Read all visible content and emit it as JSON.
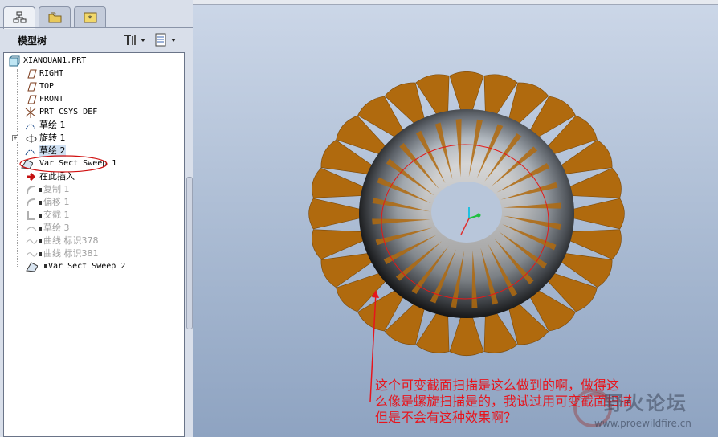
{
  "model_tree": {
    "header": "模型树",
    "root": "XIANQUAN1.PRT",
    "items": [
      {
        "label": "RIGHT"
      },
      {
        "label": "TOP"
      },
      {
        "label": "FRONT"
      },
      {
        "label": "PRT_CSYS_DEF"
      },
      {
        "label": "草绘 1"
      },
      {
        "label": "旋转 1"
      },
      {
        "label": "草绘 2"
      },
      {
        "label": "Var Sect Sweep 1"
      },
      {
        "label": "在此插入"
      },
      {
        "label": "复制 1"
      },
      {
        "label": "偏移 1"
      },
      {
        "label": "交截 1"
      },
      {
        "label": "草绘 3"
      },
      {
        "label": "曲线 标识378"
      },
      {
        "label": "曲线 标识381"
      },
      {
        "label": "Var Sect Sweep 2"
      }
    ]
  },
  "annotation": {
    "line1": "这个可变截面扫描是这么做到的啊，做得这",
    "line2": "么像是螺旋扫描是的，我试过用可变截面扫描",
    "line3": "但是不会有这种效果啊？"
  },
  "watermark": {
    "title": "野火论坛",
    "url": "www.proewildfire.cn"
  },
  "colors": {
    "blade": "#b06a0e",
    "torus_dark": "#111111",
    "torus_light": "#e8ecf0",
    "annotation_red": "#e8141c"
  }
}
